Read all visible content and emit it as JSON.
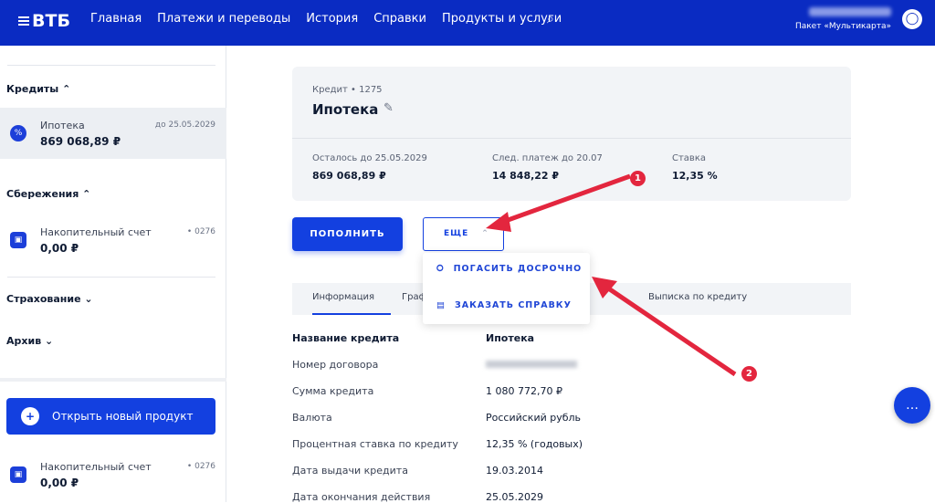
{
  "header": {
    "logo": "ВТБ",
    "nav": [
      "Главная",
      "Платежи и переводы",
      "История",
      "Справки",
      "Продукты и услуги"
    ],
    "package": "Пакет «Мультикарта»"
  },
  "sidebar": {
    "credits_label": "Кредиты",
    "credit": {
      "name": "Ипотека",
      "amount": "869 068,89 ₽",
      "due": "до 25.05.2029"
    },
    "savings_label": "Сбережения",
    "savings": {
      "name": "Накопительный счет",
      "amount": "0,00 ₽",
      "num": "• 0276"
    },
    "insurance_label": "Страхование",
    "archive_label": "Архив",
    "open_button": "Открыть новый продукт",
    "savings2": {
      "name": "Накопительный счет",
      "amount": "0,00 ₽",
      "num": "• 0276"
    }
  },
  "card": {
    "subtitle": "Кредит • 1275",
    "title": "Ипотека",
    "cols": [
      {
        "label": "Осталось до 25.05.2029",
        "value": "869 068,89 ₽"
      },
      {
        "label": "След. платеж до 20.07",
        "value": "14 848,22 ₽"
      },
      {
        "label": "Ставка",
        "value": "12,35 %"
      }
    ]
  },
  "actions": {
    "topup": "ПОПОЛНИТЬ",
    "more": "ЕЩЕ"
  },
  "dropdown": [
    "ПОГАСИТЬ ДОСРОЧНО",
    "ЗАКАЗАТЬ СПРАВКУ"
  ],
  "tabs": [
    "Информация",
    "Граф",
    "Выписка по кредиту"
  ],
  "info": [
    {
      "k": "Название кредита",
      "v": "Ипотека"
    },
    {
      "k": "Номер договора",
      "v": ""
    },
    {
      "k": "Сумма кредита",
      "v": "1 080 772,70 ₽"
    },
    {
      "k": "Валюта",
      "v": "Российский рубль"
    },
    {
      "k": "Процентная ставка по кредиту",
      "v": "12,35 % (годовых)"
    },
    {
      "k": "Дата выдачи кредита",
      "v": "19.03.2014"
    },
    {
      "k": "Дата окончания действия",
      "v": "25.05.2029"
    }
  ],
  "annotations": {
    "badge1": "1",
    "badge2": "2",
    "arrow_color": "#e3263e"
  },
  "colors": {
    "header": "#0a2bc2",
    "accent": "#1340e0"
  }
}
